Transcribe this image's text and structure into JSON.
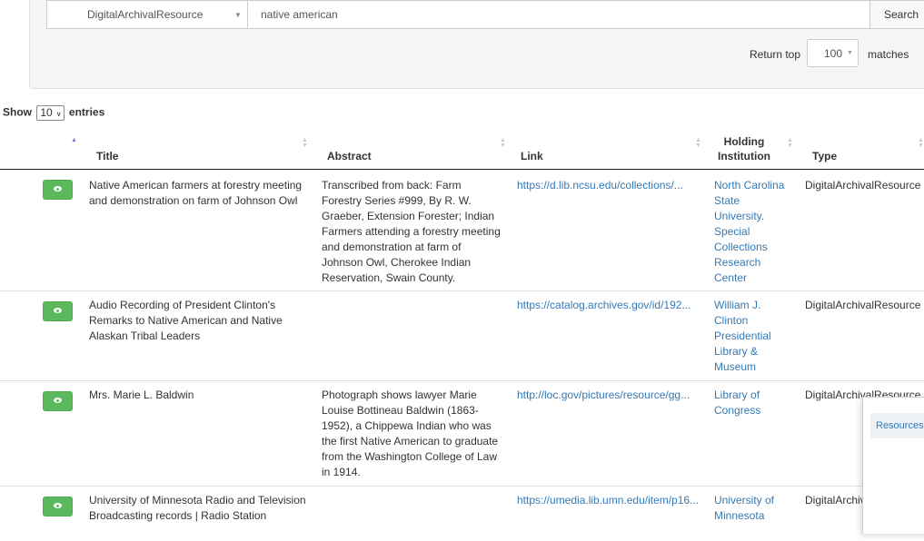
{
  "search": {
    "type_value": "DigitalArchivalResource",
    "query_value": "native american",
    "button_label": "Search",
    "return_label": "Return top",
    "return_count": "100",
    "matches_label": "matches"
  },
  "table_controls": {
    "show_label": "Show",
    "page_length": "10",
    "entries_label": "entries"
  },
  "table": {
    "headers": {
      "title": "Title",
      "abstract": "Abstract",
      "link": "Link",
      "institution_line1": "Holding",
      "institution_line2": "Institution",
      "type": "Type"
    },
    "rows": [
      {
        "title": "Native American farmers at forestry meeting and demonstration on farm of Johnson Owl",
        "abstract": "Transcribed from back: Farm Forestry Series #999, By R. W. Graeber, Extension Forester; Indian Farmers attending a forestry meeting and demonstration at farm of Johnson Owl, Cherokee Indian Reservation, Swain County.",
        "link": "https://d.lib.ncsu.edu/collections/...",
        "institution": "North Carolina State University. Special Collections Research Center",
        "type": "DigitalArchivalResource"
      },
      {
        "title": "Audio Recording of President Clinton's Remarks to Native American and Native Alaskan Tribal Leaders",
        "abstract": "",
        "link": "https://catalog.archives.gov/id/192...",
        "institution": "William J. Clinton Presidential Library & Museum",
        "type": "DigitalArchivalResource"
      },
      {
        "title": "Mrs. Marie L. Baldwin",
        "abstract": "Photograph shows lawyer Marie Louise Bottineau Baldwin (1863-1952), a Chippewa Indian who was the first Native American to graduate from the Washington College of Law in 1914.",
        "link": "http://loc.gov/pictures/resource/gg...",
        "institution": "Library of Congress",
        "type": "DigitalArchivalResource"
      },
      {
        "title": "University of Minnesota Radio and Television Broadcasting records | Radio Station",
        "abstract": "",
        "link": "https://umedia.lib.umn.edu/item/p16...",
        "institution": "University of Minnesota",
        "type": "DigitalArchivalResource"
      }
    ]
  },
  "popup": {
    "item_label": "Resources"
  },
  "colors": {
    "view_button": "#5cb85c",
    "link": "#337ab7",
    "sort_active": "#7b7fc9"
  },
  "icons": [
    "caret-down-icon",
    "sort-icon",
    "eye-icon"
  ]
}
